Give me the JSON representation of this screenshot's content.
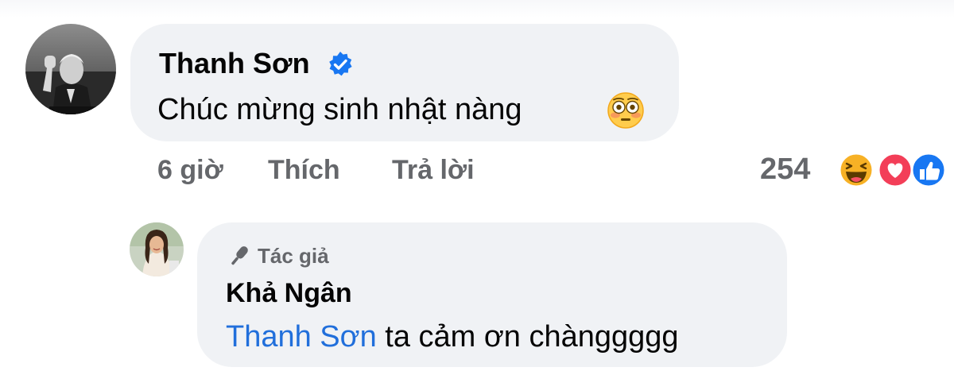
{
  "comment": {
    "author": "Thanh Sơn",
    "verified_icon": "verified-badge-icon",
    "text": "Chúc mừng sinh nhật nàng",
    "emoji": "flushed-face-emoji",
    "time": "6 giờ",
    "like_label": "Thích",
    "reply_label": "Trả lời",
    "reaction_count": "254",
    "reactions": [
      "haha",
      "love",
      "like"
    ]
  },
  "reply": {
    "badge_icon": "microphone-icon",
    "badge_label": "Tác giả",
    "author": "Khả Ngân",
    "mention": "Thanh Sơn",
    "text": " ta cảm ơn chànggggg"
  },
  "colors": {
    "bubble": "#f0f2f5",
    "secondary_text": "#65676b",
    "mention": "#216fdb",
    "verified": "#1877f2",
    "love": "#f33e58",
    "like": "#1877f2",
    "haha": "#f7b125"
  }
}
